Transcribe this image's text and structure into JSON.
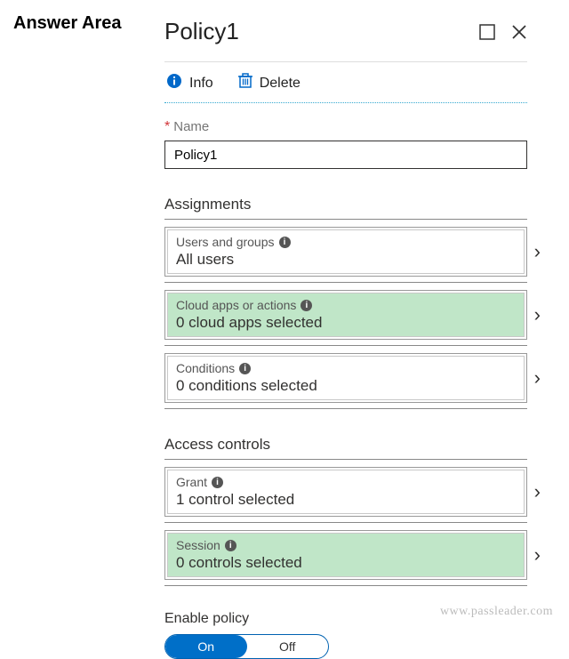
{
  "page_label": "Answer Area",
  "panel": {
    "title": "Policy1",
    "toolbar": {
      "info": "Info",
      "delete": "Delete"
    },
    "fields": {
      "name_label": "Name",
      "name_value": "Policy1"
    },
    "sections": {
      "assignments": {
        "heading": "Assignments",
        "items": [
          {
            "label": "Users and groups",
            "value": "All users",
            "highlight": false
          },
          {
            "label": "Cloud apps or actions",
            "value": "0 cloud apps selected",
            "highlight": true
          },
          {
            "label": "Conditions",
            "value": "0 conditions selected",
            "highlight": false
          }
        ]
      },
      "access_controls": {
        "heading": "Access controls",
        "items": [
          {
            "label": "Grant",
            "value": "1 control selected",
            "highlight": false
          },
          {
            "label": "Session",
            "value": "0 controls selected",
            "highlight": true
          }
        ]
      }
    },
    "enable": {
      "label": "Enable policy",
      "on": "On",
      "off": "Off",
      "state": "On"
    }
  },
  "watermark": "www.passleader.com"
}
